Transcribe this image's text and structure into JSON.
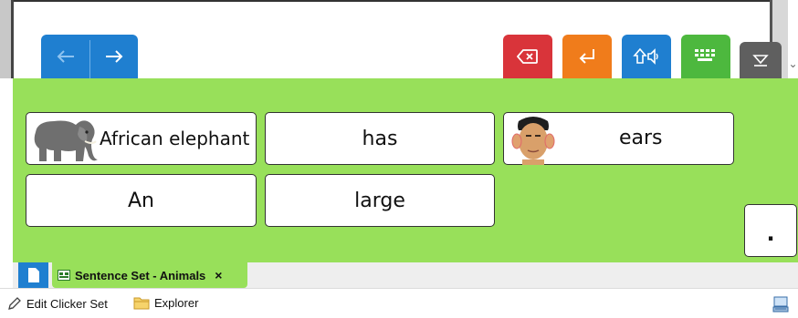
{
  "toolbar": {
    "nav_back": "back",
    "nav_forward": "forward",
    "buttons": [
      {
        "name": "delete-word-button",
        "icon": "backspace-icon",
        "color": "#d9343a"
      },
      {
        "name": "enter-button",
        "icon": "return-icon",
        "color": "#f07c1b"
      },
      {
        "name": "speak-button",
        "icon": "shift-speak-icon",
        "color": "#1f7fd0"
      },
      {
        "name": "keyboard-button",
        "icon": "keyboard-icon",
        "color": "#4db83e"
      },
      {
        "name": "hide-button",
        "icon": "collapse-icon",
        "color": "#5f5f5f"
      }
    ]
  },
  "grid": {
    "background": "#98e05a",
    "cells": [
      {
        "label": "African elephant",
        "picture": "elephant"
      },
      {
        "label": "has",
        "picture": null
      },
      {
        "label": "ears",
        "picture": "face"
      },
      {
        "label": "An",
        "picture": null
      },
      {
        "label": "large",
        "picture": null
      },
      {
        "label": ".",
        "picture": null
      }
    ]
  },
  "tabs": {
    "active_tab_label": "Sentence Set - Animals",
    "close_symbol": "×"
  },
  "bottombar": {
    "edit_label": "Edit Clicker Set",
    "explorer_label": "Explorer"
  }
}
